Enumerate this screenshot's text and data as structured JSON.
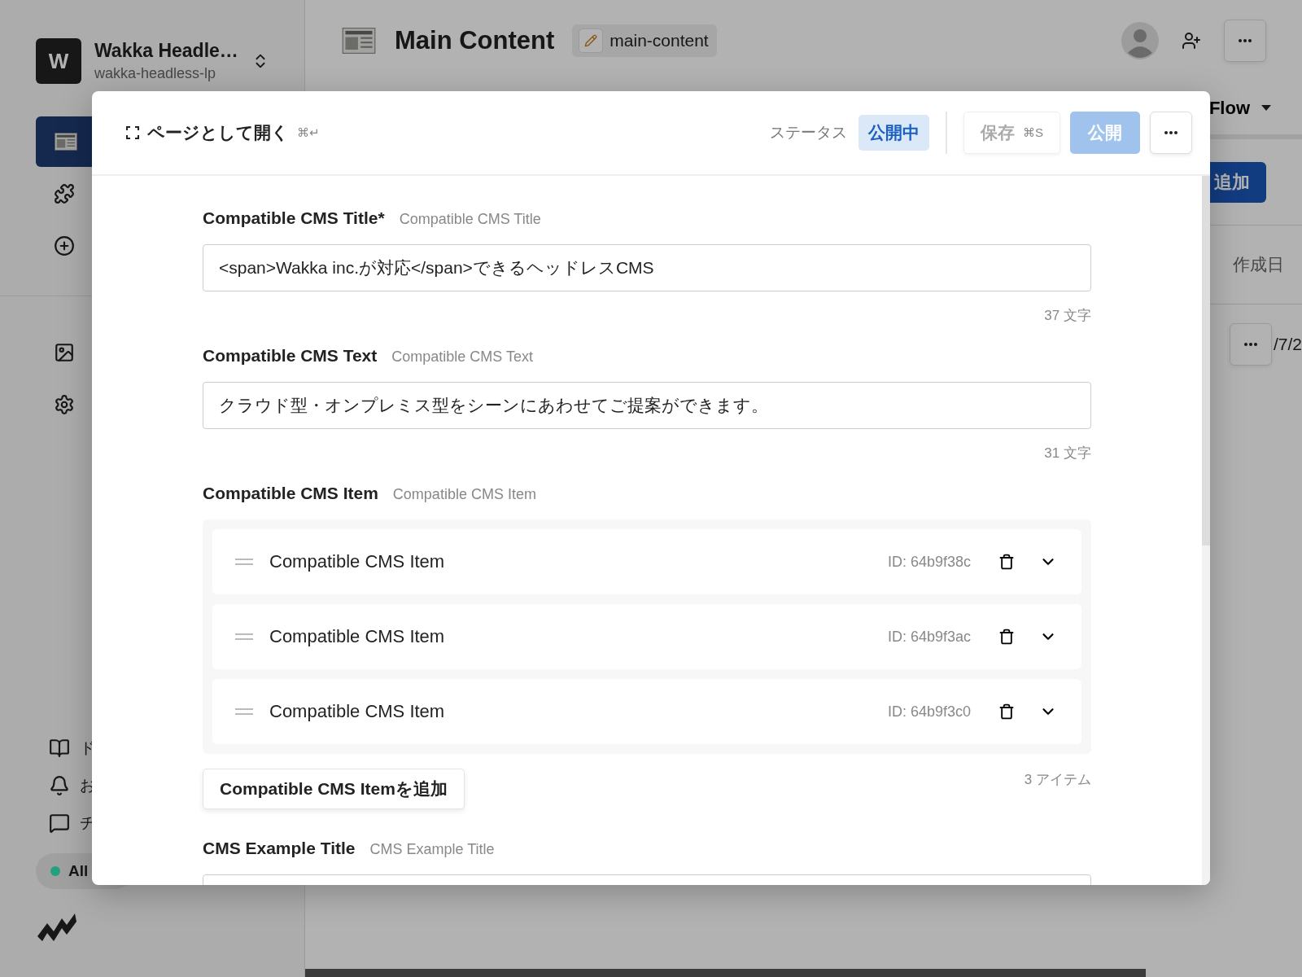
{
  "sidebar": {
    "workspace": {
      "initial": "W",
      "name": "Wakka Headle…",
      "slug": "wakka-headless-lp"
    },
    "nav_top": [
      {
        "selected": true
      },
      {
        "selected": false
      },
      {
        "selected": false
      }
    ],
    "nav_mid": [
      {
        "selected": false
      },
      {
        "selected": false
      }
    ],
    "bottom_nav": [
      {
        "label": "ド"
      },
      {
        "label": "お"
      },
      {
        "label": "チ"
      }
    ],
    "filter": {
      "label": "All",
      "color": "#25a07f"
    }
  },
  "header": {
    "title": "Main Content",
    "slug": "main-content"
  },
  "background": {
    "flow_menu": "Flow",
    "add_button": "追加",
    "column_header": "作成日",
    "row_date": "/7/2"
  },
  "modal": {
    "open_as_page": {
      "label": "ページとして開く",
      "shortcut": "⌘↵"
    },
    "status_label": "ステータス",
    "status_badge": "公開中",
    "save": {
      "label": "保存",
      "shortcut": "⌘S",
      "disabled": true
    },
    "publish": {
      "label": "公開",
      "disabled": true
    },
    "fields": [
      {
        "kind": "text",
        "label": "Compatible CMS Title*",
        "api_name": "Compatible CMS Title",
        "value": "<span>Wakka inc.が対応</span>できるヘッドレスCMS",
        "count": "37 文字"
      },
      {
        "kind": "text",
        "label": "Compatible CMS Text",
        "api_name": "Compatible CMS Text",
        "value": "クラウド型・オンプレミス型をシーンにあわせてご提案ができます。",
        "count": "31 文字"
      },
      {
        "kind": "repeater",
        "label": "Compatible CMS Item",
        "api_name": "Compatible CMS Item",
        "items": [
          {
            "title": "Compatible CMS Item",
            "id": "ID: 64b9f38c"
          },
          {
            "title": "Compatible CMS Item",
            "id": "ID: 64b9f3ac"
          },
          {
            "title": "Compatible CMS Item",
            "id": "ID: 64b9f3c0"
          }
        ],
        "add_label": "Compatible CMS Itemを追加",
        "count": "3 アイテム"
      },
      {
        "kind": "text",
        "label": "CMS Example Title",
        "api_name": "CMS Example Title"
      }
    ]
  }
}
